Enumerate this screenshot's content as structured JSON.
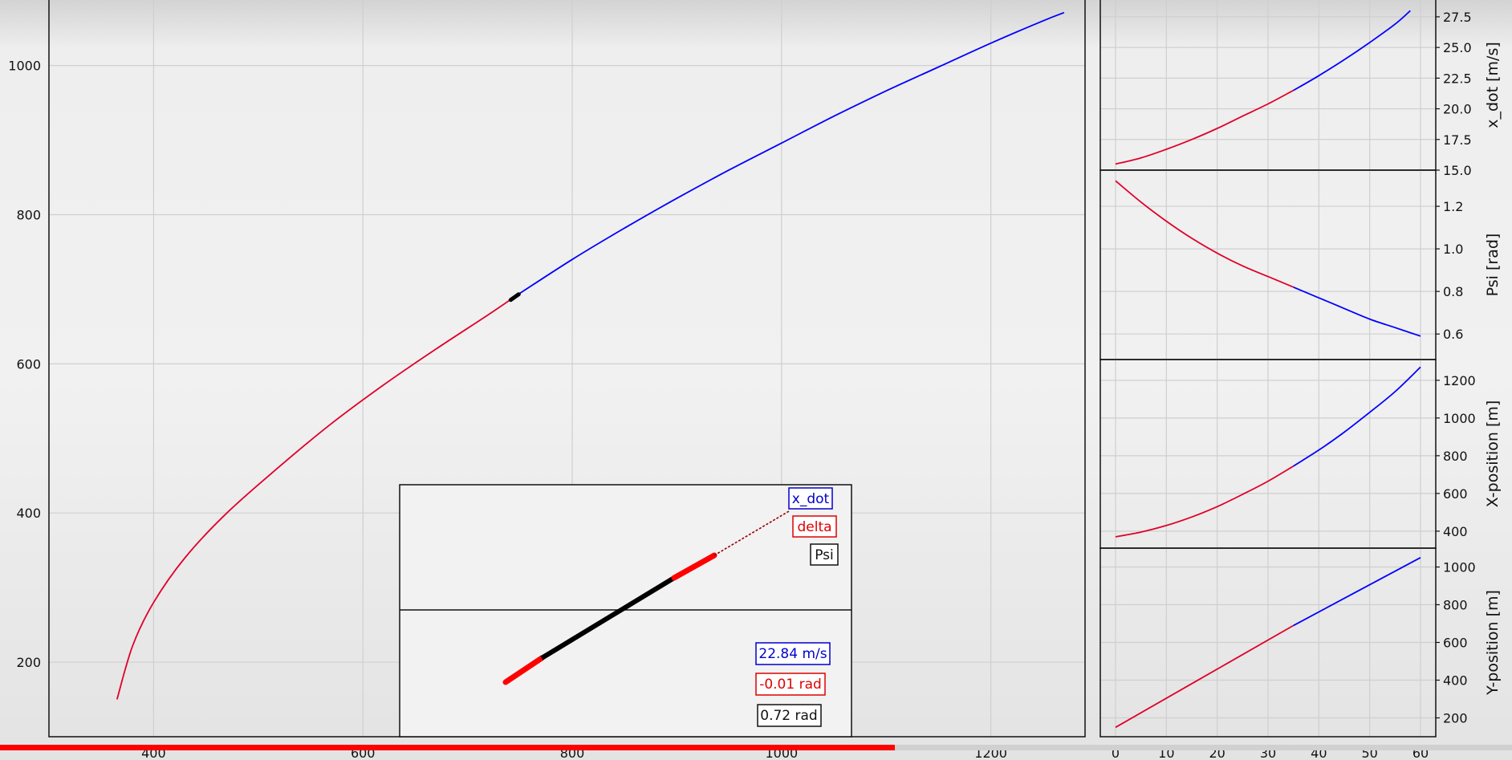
{
  "colors": {
    "blue": "#0000ff",
    "red": "#e0002a",
    "black": "#000000",
    "progress": "#ff0000"
  },
  "video_progress": 0.592,
  "chart_data": [
    {
      "id": "trajectory",
      "type": "line",
      "xlim": [
        300,
        1290
      ],
      "ylim": [
        100,
        1090
      ],
      "xticks": [
        "400",
        "600",
        "800",
        "1000",
        "1200"
      ],
      "yticks": [
        "200",
        "400",
        "600",
        "800",
        "1000"
      ],
      "grid": true,
      "series": [
        {
          "color": "red",
          "x": [
            365,
            380,
            400,
            430,
            470,
            520,
            570,
            620,
            670,
            720,
            745
          ],
          "y": [
            150,
            222,
            280,
            340,
            400,
            462,
            520,
            572,
            620,
            666,
            690
          ]
        },
        {
          "color": "blue",
          "x": [
            745,
            800,
            850,
            900,
            950,
            1000,
            1050,
            1100,
            1150,
            1200,
            1250,
            1270
          ],
          "y": [
            690,
            740,
            782,
            822,
            860,
            896,
            932,
            966,
            998,
            1030,
            1060,
            1071
          ]
        }
      ],
      "marker": {
        "x": 745,
        "y": 690,
        "color": "black"
      }
    },
    {
      "id": "x_dot",
      "type": "line",
      "xlim": [
        -3,
        63
      ],
      "ylim": [
        15.0,
        29.0
      ],
      "yticks": [
        "15.0",
        "17.5",
        "20.0",
        "22.5",
        "25.0",
        "27.5"
      ],
      "ylabel": "x_dot [m/s]",
      "grid": true,
      "series": [
        {
          "color": "red",
          "x": [
            0,
            5,
            10,
            15,
            20,
            25,
            30,
            35
          ],
          "y": [
            15.5,
            16.0,
            16.7,
            17.5,
            18.4,
            19.4,
            20.4,
            21.5
          ]
        },
        {
          "color": "blue",
          "x": [
            35,
            40,
            45,
            50,
            55,
            58
          ],
          "y": [
            21.5,
            22.7,
            24.0,
            25.4,
            26.9,
            28.0
          ]
        }
      ]
    },
    {
      "id": "psi",
      "type": "line",
      "xlim": [
        -3,
        63
      ],
      "ylim": [
        0.48,
        1.37
      ],
      "yticks": [
        "0.6",
        "0.8",
        "1.0",
        "1.2"
      ],
      "ylabel": "Psi [rad]",
      "grid": true,
      "series": [
        {
          "color": "red",
          "x": [
            0,
            5,
            10,
            15,
            20,
            25,
            30,
            35
          ],
          "y": [
            1.32,
            1.22,
            1.13,
            1.05,
            0.98,
            0.92,
            0.87,
            0.82
          ]
        },
        {
          "color": "blue",
          "x": [
            35,
            40,
            45,
            50,
            55,
            60
          ],
          "y": [
            0.82,
            0.77,
            0.72,
            0.67,
            0.63,
            0.59
          ]
        }
      ]
    },
    {
      "id": "x_position",
      "type": "line",
      "xlim": [
        -3,
        63
      ],
      "ylim": [
        310,
        1310
      ],
      "yticks": [
        "400",
        "600",
        "800",
        "1000",
        "1200"
      ],
      "ylabel": "X-position [m]",
      "grid": true,
      "series": [
        {
          "color": "red",
          "x": [
            0,
            5,
            10,
            15,
            20,
            25,
            30,
            35
          ],
          "y": [
            370,
            395,
            430,
            475,
            530,
            595,
            665,
            745
          ]
        },
        {
          "color": "blue",
          "x": [
            35,
            40,
            45,
            50,
            55,
            60
          ],
          "y": [
            745,
            830,
            925,
            1030,
            1140,
            1270
          ]
        }
      ]
    },
    {
      "id": "y_position",
      "type": "line",
      "xlim": [
        -3,
        63
      ],
      "ylim": [
        100,
        1100
      ],
      "xticks": [
        "0",
        "10",
        "20",
        "30",
        "40",
        "50",
        "60"
      ],
      "yticks": [
        "200",
        "400",
        "600",
        "800",
        "1000"
      ],
      "ylabel": "Y-position [m]",
      "grid": true,
      "series": [
        {
          "color": "red",
          "x": [
            0,
            35
          ],
          "y": [
            150,
            690
          ]
        },
        {
          "color": "blue",
          "x": [
            35,
            60
          ],
          "y": [
            690,
            1050
          ]
        }
      ]
    }
  ],
  "inset": {
    "labels": {
      "x_dot": "x_dot",
      "delta": "delta",
      "psi": "Psi"
    },
    "values": {
      "x_dot": "22.84 m/s",
      "delta": "-0.01 rad",
      "psi": "0.72 rad"
    }
  }
}
